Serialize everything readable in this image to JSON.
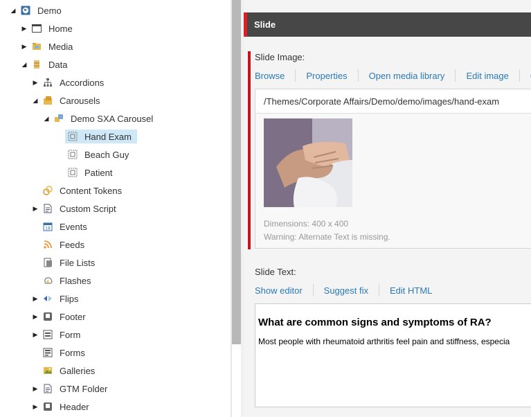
{
  "tree": {
    "items": [
      {
        "label": "Demo",
        "icon": "globe-icon"
      },
      {
        "label": "Home",
        "icon": "window-icon"
      },
      {
        "label": "Media",
        "icon": "media-folder-icon"
      },
      {
        "label": "Data",
        "icon": "data-cylinder-icon"
      },
      {
        "label": "Accordions",
        "icon": "hierarchy-icon"
      },
      {
        "label": "Carousels",
        "icon": "carousel-folder-icon"
      },
      {
        "label": "Demo SXA Carousel",
        "icon": "carousel-icon"
      },
      {
        "label": "Hand Exam",
        "icon": "slide-icon",
        "selected": true
      },
      {
        "label": "Beach Guy",
        "icon": "slide-icon"
      },
      {
        "label": "Patient",
        "icon": "slide-icon"
      },
      {
        "label": "Content Tokens",
        "icon": "tokens-icon"
      },
      {
        "label": "Custom Script",
        "icon": "script-icon"
      },
      {
        "label": "Events",
        "icon": "calendar-icon"
      },
      {
        "label": "Feeds",
        "icon": "rss-icon"
      },
      {
        "label": "File Lists",
        "icon": "file-list-icon"
      },
      {
        "label": "Flashes",
        "icon": "flash-icon"
      },
      {
        "label": "Flips",
        "icon": "flip-icon"
      },
      {
        "label": "Footer",
        "icon": "footer-icon"
      },
      {
        "label": "Form",
        "icon": "form-icon"
      },
      {
        "label": "Forms",
        "icon": "forms-icon"
      },
      {
        "label": "Galleries",
        "icon": "gallery-icon"
      },
      {
        "label": "GTM Folder",
        "icon": "gtm-folder-icon"
      },
      {
        "label": "Header",
        "icon": "header-icon"
      }
    ]
  },
  "section": {
    "title": "Slide"
  },
  "slide_image": {
    "label": "Slide Image:",
    "actions": [
      "Browse",
      "Properties",
      "Open media library",
      "Edit image",
      "Cl"
    ],
    "path": "/Themes/Corporate Affairs/Demo/demo/images/hand-exam",
    "dimensions": "Dimensions: 400 x 400",
    "warning": "Warning: Alternate Text is missing."
  },
  "slide_text": {
    "label": "Slide Text:",
    "actions": [
      "Show editor",
      "Suggest fix",
      "Edit HTML"
    ],
    "heading": "What are common signs and symptoms of RA?",
    "body": "Most people with rheumatoid arthritis feel pain and stiffness, especia"
  },
  "colors": {
    "accent_red": "#dc1f26",
    "link_blue": "#2a79b4",
    "header_bg": "#474747",
    "selection": "#cfe8f7"
  }
}
